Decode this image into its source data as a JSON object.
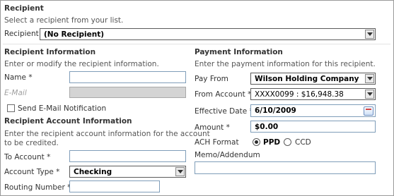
{
  "recipient": {
    "heading": "Recipient",
    "instruction": "Select a recipient from your list.",
    "label": "Recipient",
    "selected": "(No Recipient)"
  },
  "recipient_info": {
    "heading": "Recipient Information",
    "instruction": "Enter or modify the recipient information.",
    "name_label": "Name *",
    "name_value": "",
    "email_label": "E-Mail",
    "email_value": "",
    "notify_label": "Send E-Mail Notification"
  },
  "account_info": {
    "heading": "Recipient Account Information",
    "instruction_line1": "Enter the recipient account information for the account",
    "instruction_line2": "to be credited.",
    "to_account_label": "To Account *",
    "to_account_value": "",
    "account_type_label": "Account Type *",
    "account_type_selected": "Checking",
    "routing_label": "Routing Number *",
    "routing_value": ""
  },
  "payment_info": {
    "heading": "Payment Information",
    "instruction": "Enter the payment information for this recipient.",
    "pay_from_label": "Pay From",
    "pay_from_selected": "Wilson Holding Company",
    "from_account_label": "From Account *",
    "from_account_selected": "XXXX0099 : $16,948.38",
    "effective_date_label": "Effective Date *",
    "effective_date_value": "6/10/2009",
    "amount_label": "Amount *",
    "amount_value": "$0.00",
    "ach_format_label": "ACH Format",
    "ach_options": [
      "PPD",
      "CCD"
    ],
    "ach_selected": "PPD",
    "memo_label": "Memo/Addendum",
    "memo_value": ""
  }
}
